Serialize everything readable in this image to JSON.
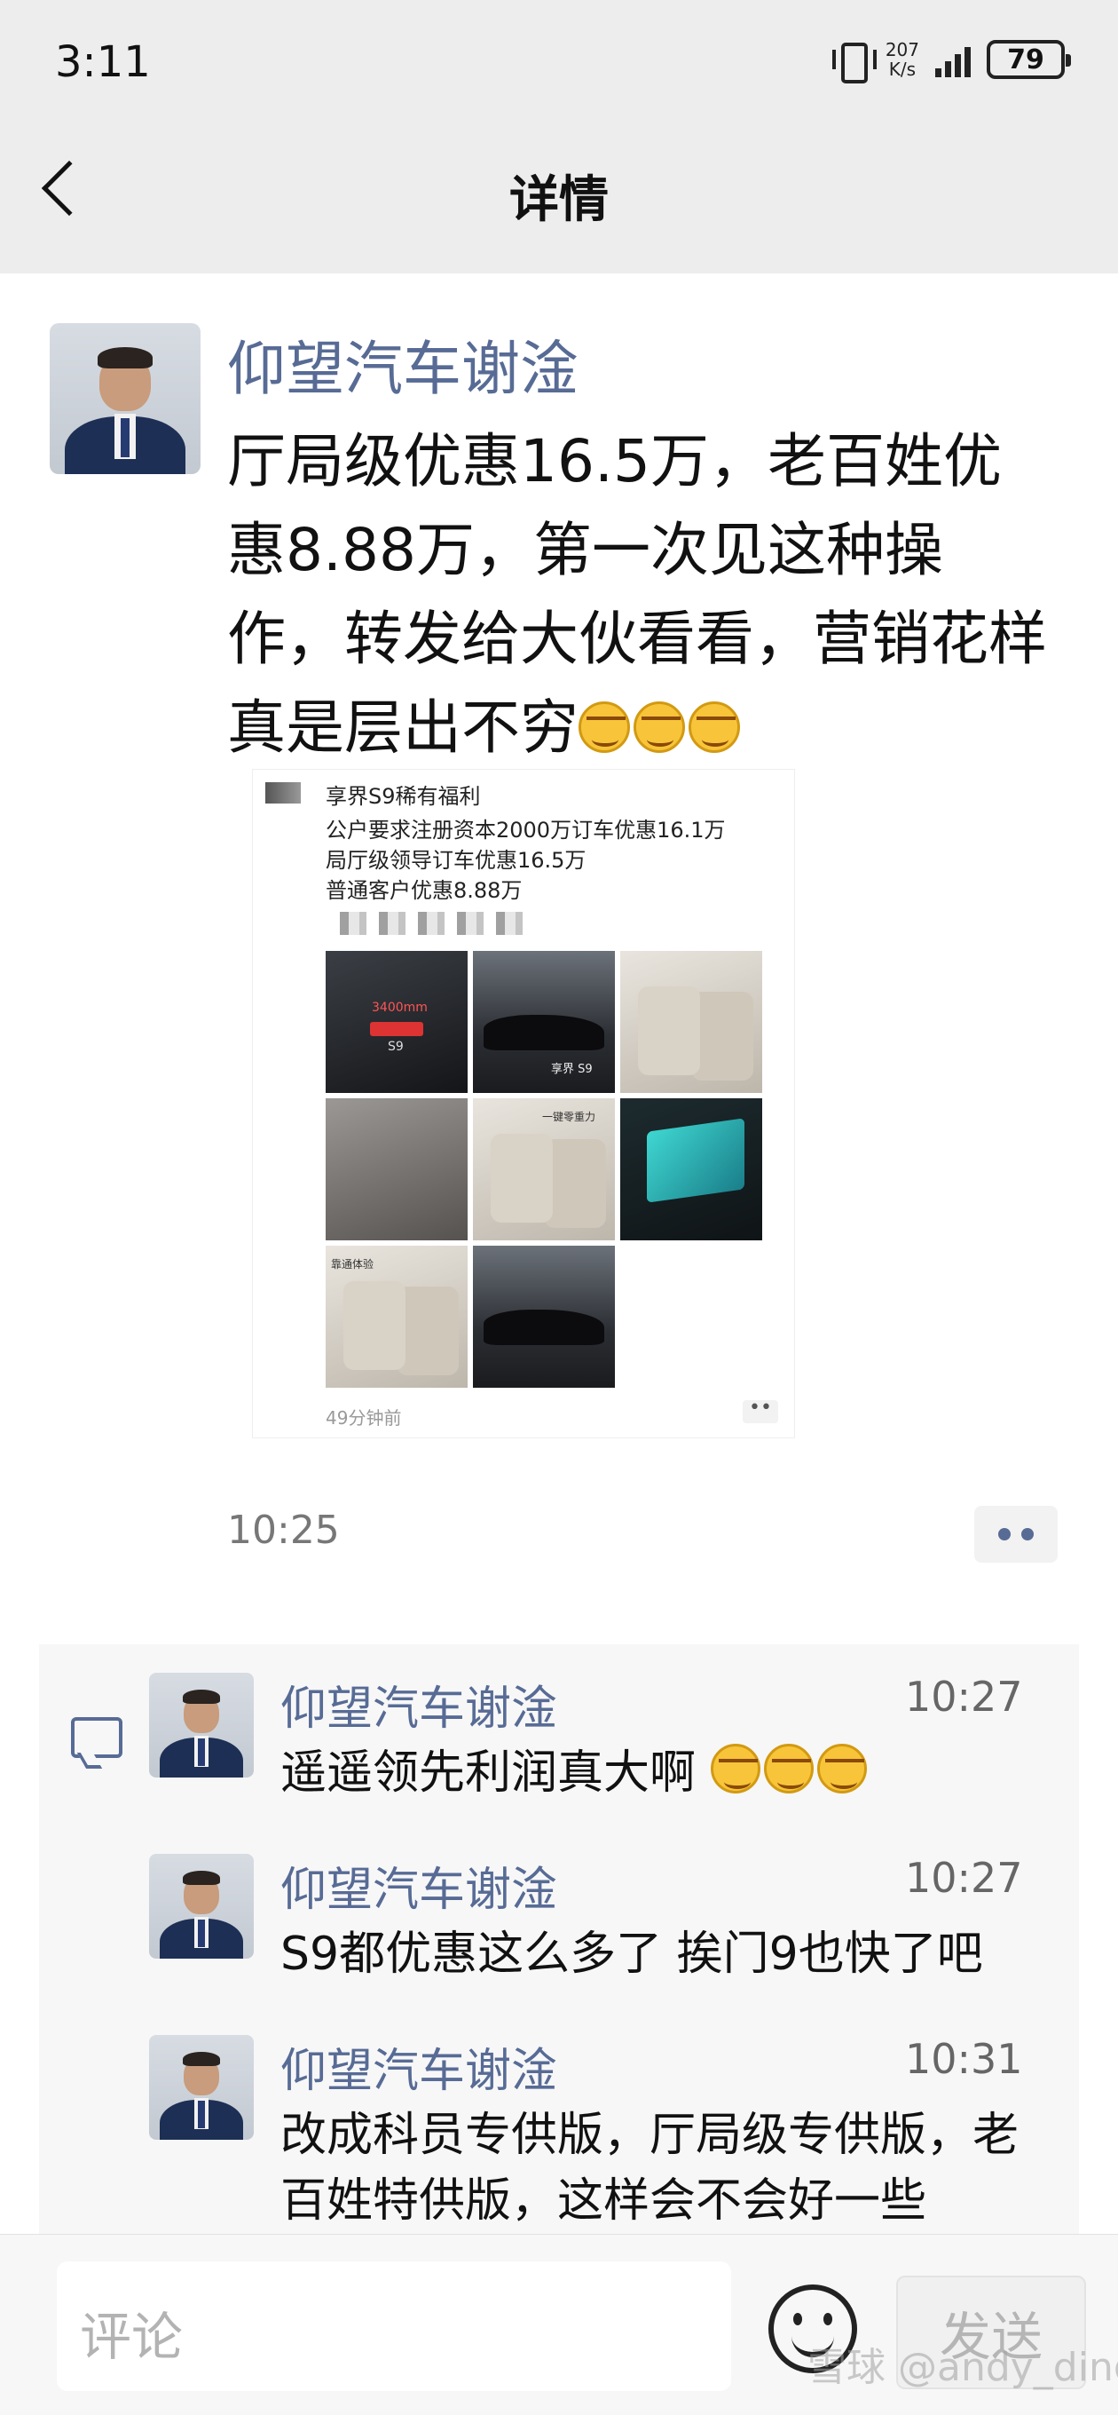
{
  "status_bar": {
    "time": "3:11",
    "net_speed_value": "207",
    "net_speed_unit": "K/s",
    "battery": "79"
  },
  "header": {
    "title": "详情",
    "back_icon": "chevron-left-icon"
  },
  "post": {
    "author": "仰望汽车谢淦",
    "text": "厅局级优惠16.5万，老百姓优惠8.88万，第一次见这种操作，转发给大伙看看，营销花样真是层出不穷",
    "emoji_count": 3,
    "time": "10:25",
    "shared_image": {
      "title": "享界S9稀有福利",
      "lines": [
        "公户要求注册资本2000万订车优惠16.1万",
        "局厅级领导订车优惠16.5万",
        "普通客户优惠8.88万"
      ],
      "thumb_texts": [
        "3400mm",
        "S9",
        "享界 S9",
        "一键零重力",
        "靠通体验"
      ],
      "time": "49分钟前"
    }
  },
  "comments": [
    {
      "name": "仰望汽车谢淦",
      "time": "10:27",
      "text": "遥遥领先利润真大啊",
      "emoji_count": 3
    },
    {
      "name": "仰望汽车谢淦",
      "time": "10:27",
      "text": "S9都优惠这么多了 挨门9也快了吧",
      "emoji_count": 0
    },
    {
      "name": "仰望汽车谢淦",
      "time": "10:31",
      "text": "改成科员专供版，厅局级专供版，老百姓特供版，这样会不会好一些",
      "emoji_count": 0
    }
  ],
  "bottom_bar": {
    "input_placeholder": "评论",
    "send_label": "发送",
    "watermark": "雪球 @andy_ding"
  },
  "colors": {
    "link_blue": "#576b95",
    "header_bg": "#ededed"
  }
}
